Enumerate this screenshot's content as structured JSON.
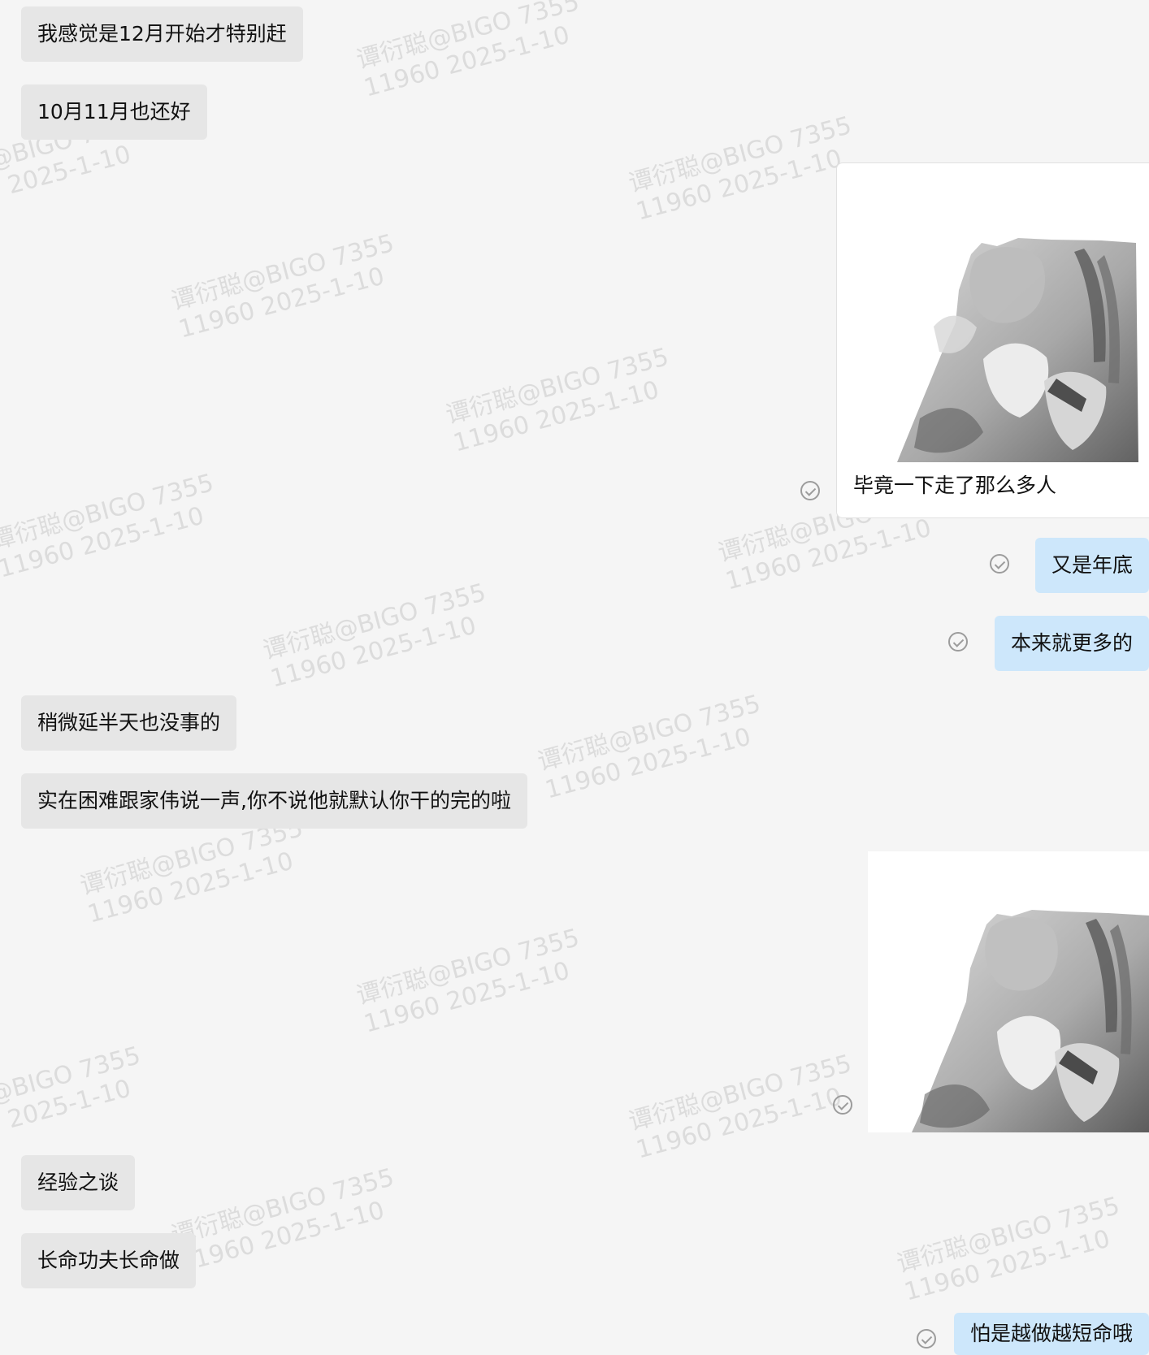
{
  "watermark": {
    "line1": "谭衍聪@BIGO 7355",
    "line2": "11960 2025-1-10"
  },
  "messages": [
    {
      "side": "left",
      "text": "我感觉是12月开始才特别赶"
    },
    {
      "side": "left",
      "text": "10月11月也还好"
    },
    {
      "side": "right",
      "kind": "sticker-with-caption",
      "caption": "毕竟一下走了那么多人",
      "image_icon": "cat-sticker-icon",
      "status_icon": "read-check-icon"
    },
    {
      "side": "right",
      "text": "又是年底",
      "status_icon": "read-check-icon"
    },
    {
      "side": "right",
      "text": "本来就更多的",
      "status_icon": "read-check-icon"
    },
    {
      "side": "left",
      "text": "稍微延半天也没事的"
    },
    {
      "side": "left",
      "text": "实在困难跟家伟说一声,你不说他就默认你干的完的啦"
    },
    {
      "side": "right",
      "kind": "sticker",
      "image_icon": "cat-sticker-icon",
      "status_icon": "read-check-icon"
    },
    {
      "side": "left",
      "text": "经验之谈"
    },
    {
      "side": "left",
      "text": "长命功夫长命做"
    },
    {
      "side": "right",
      "text": "怕是越做越短命哦",
      "status_icon": "read-check-icon"
    }
  ],
  "colors": {
    "background": "#f5f5f5",
    "incoming_bubble": "#e6e6e6",
    "outgoing_bubble": "#cde7fb",
    "text": "#111111",
    "check": "#9c9c9c"
  }
}
